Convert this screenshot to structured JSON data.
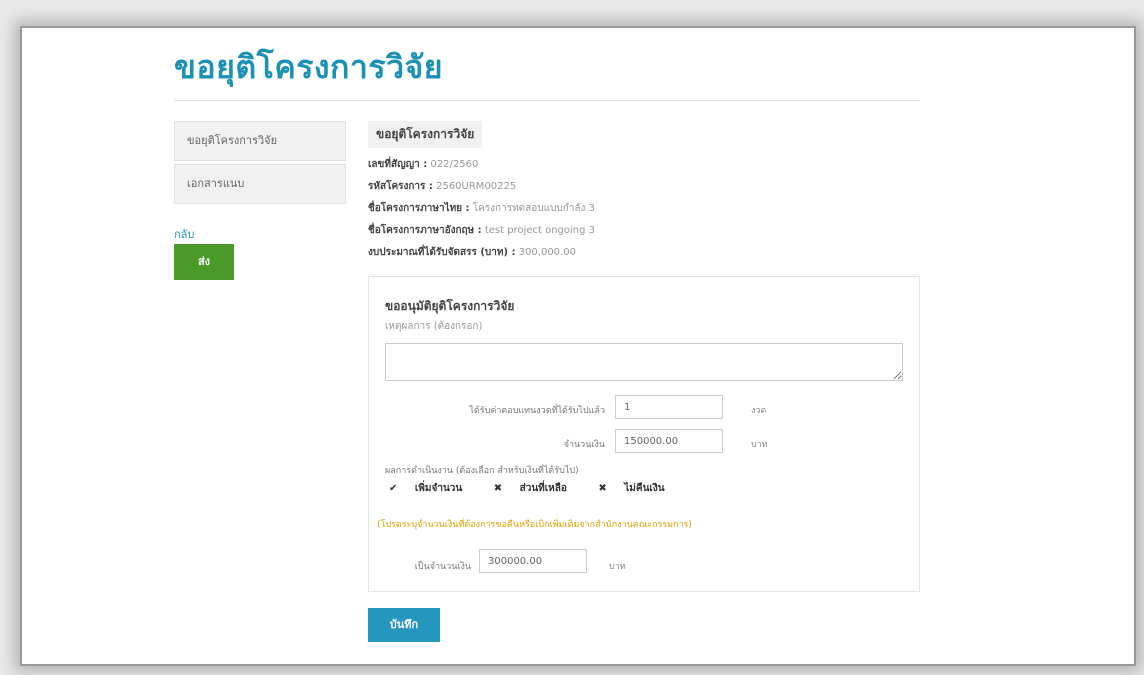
{
  "page": {
    "title": "ขอยุติโครงการวิจัย"
  },
  "sidebar": {
    "items": [
      {
        "label": "ขอยุติโครงการวิจัย"
      },
      {
        "label": "เอกสารแนบ"
      }
    ],
    "back_label": "กลับ",
    "send_label": "ส่ง"
  },
  "info": {
    "heading": "ขอยุติโครงการวิจัย",
    "rows": [
      {
        "label": "เลขที่สัญญา :",
        "value": "022/2560"
      },
      {
        "label": "รหัสโครงการ :",
        "value": "2560URM00225"
      },
      {
        "label": "ชื่อโครงการภาษาไทย :",
        "value": "โครงการทดสอบแบบกำลัง 3"
      },
      {
        "label": "ชื่อโครงการภาษาอังกฤษ :",
        "value": "test project ongoing 3"
      },
      {
        "label": "งบประมาณที่ได้รับจัดสรร (บาท) :",
        "value": "300,000.00"
      }
    ]
  },
  "form": {
    "title": "ขออนุมัติยุติโครงการวิจัย",
    "reason_label": "เหตุผลการ (ต้องกรอก)",
    "reason_value": "",
    "installments_label": "ได้รับค่าตอบแทนงวดที่ได้รับไปแล้ว",
    "installments_value": "1",
    "installments_unit": "งวด",
    "amount_label": "จำนวนเงิน",
    "amount_value": "150000.00",
    "amount_unit": "บาท",
    "policy_label": "ผลการดำเนินงาน (ต้องเลือก สำหรับเงินที่ได้รับไป)",
    "options": [
      {
        "mark": "✔",
        "label": "เพิ่มจำนวน"
      },
      {
        "mark": "✖",
        "label": "ส่วนที่เหลือ"
      },
      {
        "mark": "✖",
        "label": "ไม่คืนเงิน"
      }
    ],
    "note": "(โปรดระบุจำนวนเงินที่ต้องการขอคืนหรือเบิกเพิ่มเติมจากสำนักงานคณะกรรมการ)",
    "refund_label": "เป็นจำนวนเงิน",
    "refund_value": "300000.00",
    "refund_unit": "บาท",
    "save_label": "บันทึก"
  },
  "colors": {
    "title": "#1b92b5",
    "send": "#4a9a2a",
    "save": "#2596be",
    "note": "#e0a000"
  }
}
